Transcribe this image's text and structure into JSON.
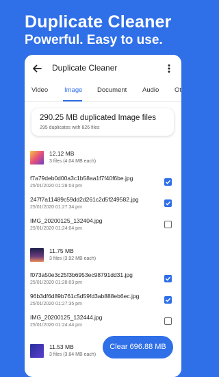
{
  "promo": {
    "title": "Duplicate Cleaner",
    "subtitle": "Powerful. Easy to use."
  },
  "appbar": {
    "title": "Duplicate Cleaner",
    "back_icon": "arrow-left-icon",
    "more_icon": "more-vert-icon"
  },
  "tabs": [
    {
      "label": "Video",
      "active": false
    },
    {
      "label": "Image",
      "active": true
    },
    {
      "label": "Document",
      "active": false
    },
    {
      "label": "Audio",
      "active": false
    },
    {
      "label": "Ot",
      "active": false
    }
  ],
  "summary": {
    "title": "290.25 MB duplicated Image files",
    "subtitle": "295 duplicates with 826 files"
  },
  "groups": [
    {
      "size": "12.12 MB",
      "count": "3 files (4.04 MB each)",
      "files": [
        {
          "name": "f7a79deb0d00a3c1b58aa1f7f40f6be.jpg",
          "date": "25/01/2020 01:28:03 pm",
          "checked": true
        },
        {
          "name": "247f7a11489c59dd2d261c2d5f249582.jpg",
          "date": "25/01/2020 01:27:34 pm",
          "checked": true
        },
        {
          "name": "IMG_20200125_132404.jpg",
          "date": "25/01/2020 01:24:04 pm",
          "checked": false
        }
      ]
    },
    {
      "size": "11.75 MB",
      "count": "3 files (3.92 MB each)",
      "files": [
        {
          "name": "f073a50e3c25f3b6953ec98791dd31.jpg",
          "date": "25/01/2020 01:28:03 pm",
          "checked": true
        },
        {
          "name": "96b3df6d89b761c5d59fd3ab888eb6ec.jpg",
          "date": "25/01/2020 01:27:35 pm",
          "checked": true
        },
        {
          "name": "IMG_20200125_132444.jpg",
          "date": "25/01/2020 01:24:44 pm",
          "checked": false
        }
      ]
    },
    {
      "size": "11.53 MB",
      "count": "3 files (3.84 MB each)",
      "files": []
    }
  ],
  "clear_button": {
    "label": "Clear 696.88 MB"
  },
  "colors": {
    "accent": "#2f6fe8",
    "background": "#2f6fe8",
    "card": "#ffffff"
  }
}
